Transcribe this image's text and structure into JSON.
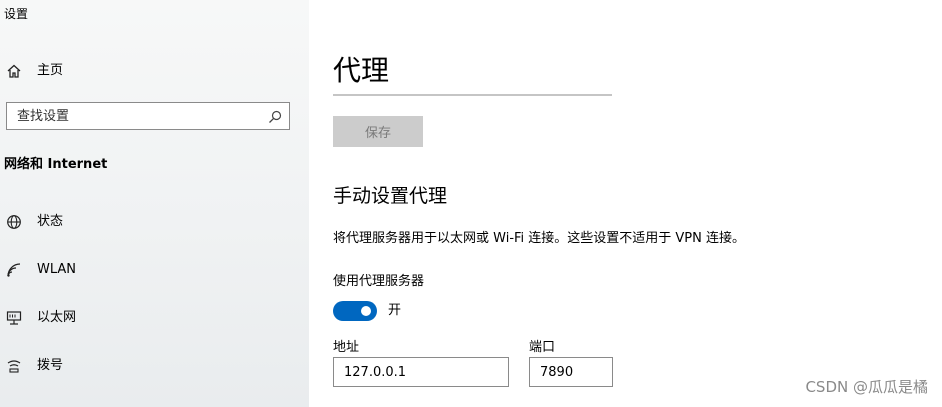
{
  "window": {
    "title": "设置"
  },
  "sidebar": {
    "home": {
      "label": "主页",
      "icon": "home-icon"
    },
    "search": {
      "placeholder": "查找设置",
      "icon": "search-icon"
    },
    "section_title": "网络和 Internet",
    "items": [
      {
        "label": "状态",
        "icon": "globe-icon"
      },
      {
        "label": "WLAN",
        "icon": "wifi-icon"
      },
      {
        "label": "以太网",
        "icon": "ethernet-icon"
      },
      {
        "label": "拨号",
        "icon": "dialup-icon"
      }
    ]
  },
  "main": {
    "title": "代理",
    "save_label": "保存",
    "manual_heading": "手动设置代理",
    "description": "将代理服务器用于以太网或 Wi-Fi 连接。这些设置不适用于 VPN 连接。",
    "use_proxy_label": "使用代理服务器",
    "toggle": {
      "on": true,
      "state_label": "开"
    },
    "address": {
      "label": "地址",
      "value": "127.0.0.1"
    },
    "port": {
      "label": "端口",
      "value": "7890"
    }
  },
  "watermark": "CSDN @瓜瓜是橘",
  "colors": {
    "accent": "#0067c0",
    "sidebar_bg": "#f0f2f3",
    "disabled_button": "#cccccc",
    "watermark": "#8a8a8a"
  }
}
